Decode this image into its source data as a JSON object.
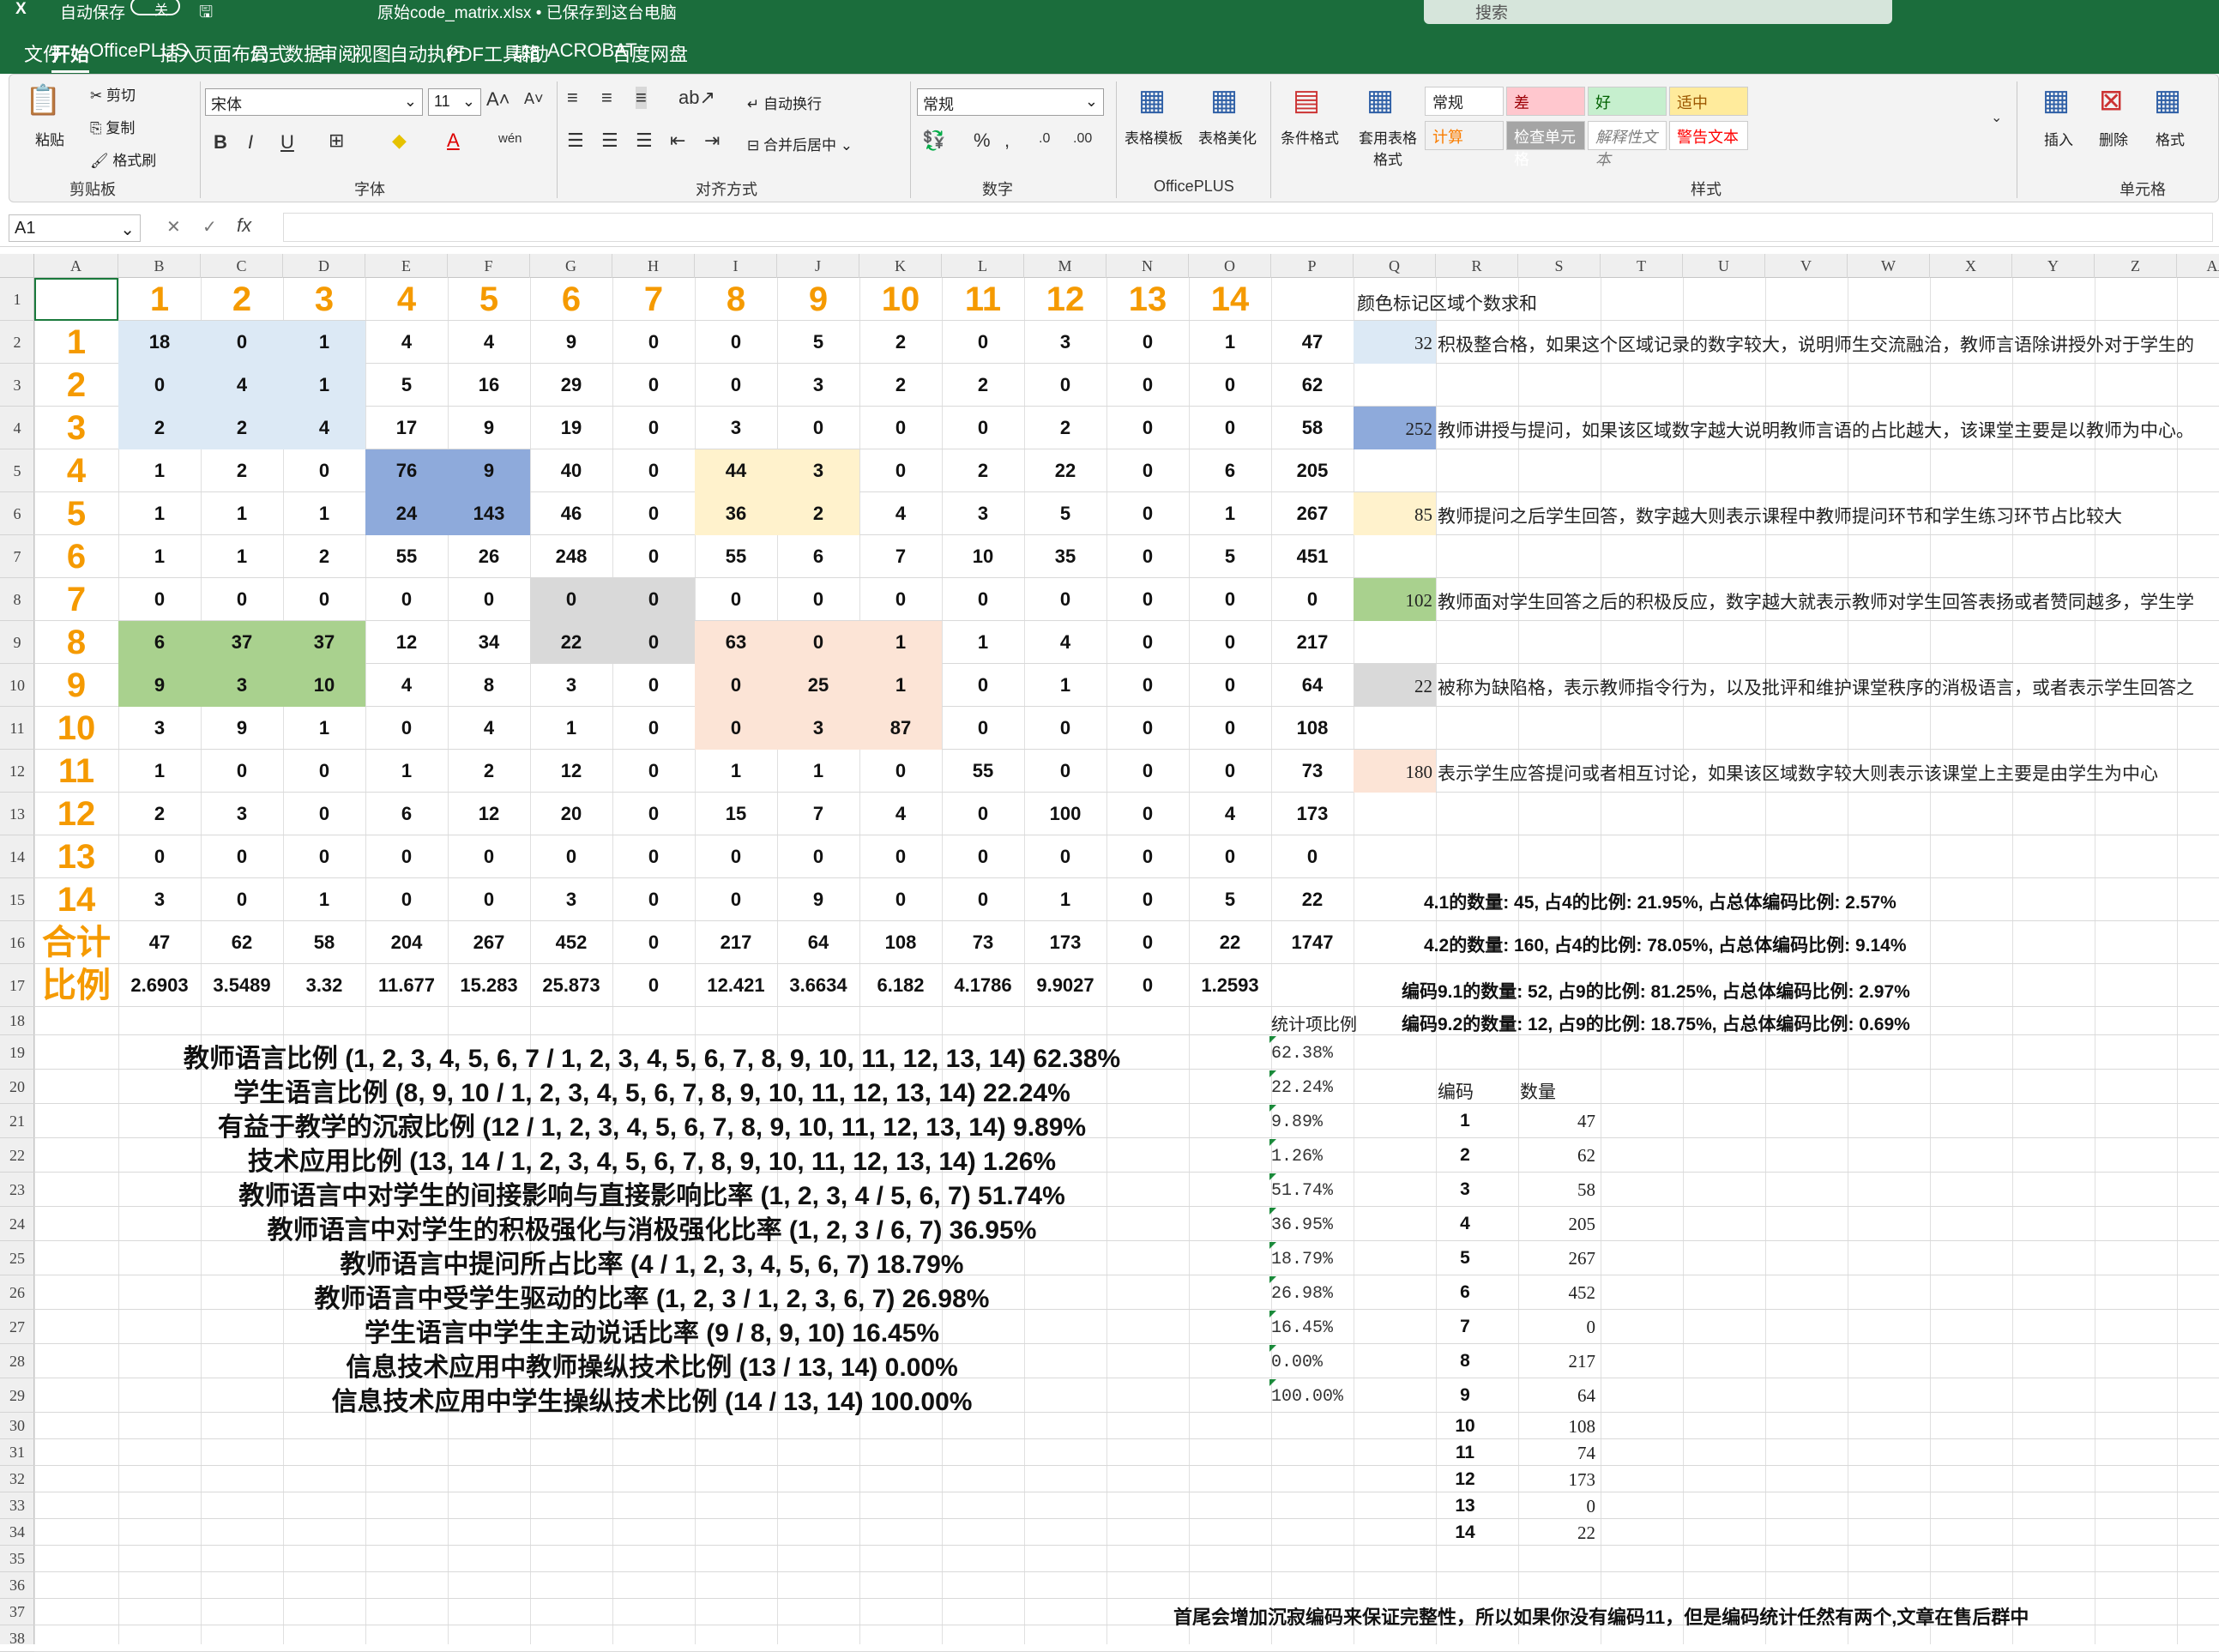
{
  "titlebar": {
    "autosave_label": "自动保存",
    "autosave_state": "关",
    "file_title": "原始code_matrix.xlsx • 已保存到这台电脑",
    "search_placeholder": "搜索"
  },
  "tabs": [
    "文件",
    "开始",
    "OfficePLUS",
    "插入",
    "页面布局",
    "公式",
    "数据",
    "审阅",
    "视图",
    "自动执行",
    "PDF工具箱",
    "帮助",
    "ACROBAT",
    "百度网盘"
  ],
  "ribbon": {
    "clipboard": {
      "paste": "粘贴",
      "cut": "剪切",
      "copy": "复制",
      "format_painter": "格式刷",
      "group": "剪贴板"
    },
    "font": {
      "name": "宋体",
      "size": "11",
      "group": "字体"
    },
    "align": {
      "wrap": "自动换行",
      "merge": "合并后居中",
      "group": "对齐方式"
    },
    "number": {
      "format": "常规",
      "group": "数字"
    },
    "officeplus": {
      "template": "表格模板",
      "beautify": "表格美化",
      "group": "OfficePLUS"
    },
    "styles": {
      "conditional": "条件格式",
      "table_fmt": "套用表格格式",
      "cells": [
        "常规",
        "差",
        "好",
        "适中",
        "计算",
        "检查单元格",
        "解释性文本",
        "警告文本"
      ],
      "group": "样式"
    },
    "cells": {
      "insert": "插入",
      "delete": "删除",
      "format": "格式",
      "group": "单元格"
    }
  },
  "formula_bar": {
    "name_box": "A1",
    "fx": "fx"
  },
  "columns": [
    "A",
    "B",
    "C",
    "D",
    "E",
    "F",
    "G",
    "H",
    "I",
    "J",
    "K",
    "L",
    "M",
    "N",
    "O",
    "P",
    "Q",
    "R",
    "S",
    "T",
    "U",
    "V",
    "W",
    "X",
    "Y",
    "Z",
    "AA"
  ],
  "rows": [
    "1",
    "2",
    "3",
    "4",
    "5",
    "6",
    "7",
    "8",
    "9",
    "10",
    "11",
    "12",
    "13",
    "14",
    "15",
    "16",
    "17",
    "18",
    "19",
    "20",
    "21",
    "22",
    "23",
    "24",
    "25",
    "26",
    "27",
    "28",
    "29",
    "30",
    "31",
    "32",
    "33",
    "34",
    "35",
    "36",
    "37",
    "38"
  ],
  "matrix": {
    "col_headers": [
      "1",
      "2",
      "3",
      "4",
      "5",
      "6",
      "7",
      "8",
      "9",
      "10",
      "11",
      "12",
      "13",
      "14"
    ],
    "row_headers": [
      "1",
      "2",
      "3",
      "4",
      "5",
      "6",
      "7",
      "8",
      "9",
      "10",
      "11",
      "12",
      "13",
      "14"
    ],
    "values": [
      [
        "18",
        "0",
        "1",
        "4",
        "4",
        "9",
        "0",
        "0",
        "5",
        "2",
        "0",
        "3",
        "0",
        "1",
        "47"
      ],
      [
        "0",
        "4",
        "1",
        "5",
        "16",
        "29",
        "0",
        "0",
        "3",
        "2",
        "2",
        "0",
        "0",
        "0",
        "62"
      ],
      [
        "2",
        "2",
        "4",
        "17",
        "9",
        "19",
        "0",
        "3",
        "0",
        "0",
        "0",
        "2",
        "0",
        "0",
        "58"
      ],
      [
        "1",
        "2",
        "0",
        "76",
        "9",
        "40",
        "0",
        "44",
        "3",
        "0",
        "2",
        "22",
        "0",
        "6",
        "205"
      ],
      [
        "1",
        "1",
        "1",
        "24",
        "143",
        "46",
        "0",
        "36",
        "2",
        "4",
        "3",
        "5",
        "0",
        "1",
        "267"
      ],
      [
        "1",
        "1",
        "2",
        "55",
        "26",
        "248",
        "0",
        "55",
        "6",
        "7",
        "10",
        "35",
        "0",
        "5",
        "451"
      ],
      [
        "0",
        "0",
        "0",
        "0",
        "0",
        "0",
        "0",
        "0",
        "0",
        "0",
        "0",
        "0",
        "0",
        "0",
        "0"
      ],
      [
        "6",
        "37",
        "37",
        "12",
        "34",
        "22",
        "0",
        "63",
        "0",
        "1",
        "1",
        "4",
        "0",
        "0",
        "217"
      ],
      [
        "9",
        "3",
        "10",
        "4",
        "8",
        "3",
        "0",
        "0",
        "25",
        "1",
        "0",
        "1",
        "0",
        "0",
        "64"
      ],
      [
        "3",
        "9",
        "1",
        "0",
        "4",
        "1",
        "0",
        "0",
        "3",
        "87",
        "0",
        "0",
        "0",
        "0",
        "108"
      ],
      [
        "1",
        "0",
        "0",
        "1",
        "2",
        "12",
        "0",
        "1",
        "1",
        "0",
        "55",
        "0",
        "0",
        "0",
        "73"
      ],
      [
        "2",
        "3",
        "0",
        "6",
        "12",
        "20",
        "0",
        "15",
        "7",
        "4",
        "0",
        "100",
        "0",
        "4",
        "173"
      ],
      [
        "0",
        "0",
        "0",
        "0",
        "0",
        "0",
        "0",
        "0",
        "0",
        "0",
        "0",
        "0",
        "0",
        "0",
        "0"
      ],
      [
        "3",
        "0",
        "1",
        "0",
        "0",
        "3",
        "0",
        "0",
        "9",
        "0",
        "0",
        "1",
        "0",
        "5",
        "22"
      ]
    ],
    "total_label": "合计",
    "totals": [
      "47",
      "62",
      "58",
      "204",
      "267",
      "452",
      "0",
      "217",
      "64",
      "108",
      "73",
      "173",
      "0",
      "22",
      "1747"
    ],
    "ratio_label": "比例",
    "ratios": [
      "2.6903",
      "3.5489",
      "3.32",
      "11.677",
      "15.283",
      "25.873",
      "0",
      "12.421",
      "3.6634",
      "6.182",
      "4.1786",
      "9.9027",
      "0",
      "1.2593"
    ]
  },
  "color_legend": {
    "title": "颜色标记区域个数求和",
    "items": [
      {
        "value": "32",
        "color": "#dce9f5",
        "text": "积极整合格，如果这个区域记录的数字较大，说明师生交流融洽，教师言语除讲授外对于学生的"
      },
      {
        "value": "252",
        "color": "#8eaadb",
        "text": "教师讲授与提问，如果该区域数字越大说明教师言语的占比越大，该课堂主要是以教师为中心。"
      },
      {
        "value": "85",
        "color": "#fff2cc",
        "text": "教师提问之后学生回答，数字越大则表示课程中教师提问环节和学生练习环节占比较大"
      },
      {
        "value": "102",
        "color": "#a9d18e",
        "text": "教师面对学生回答之后的积极反应，数字越大就表示教师对学生回答表扬或者赞同越多，学生学"
      },
      {
        "value": "22",
        "color": "#d9d9d9",
        "text": "被称为缺陷格，表示教师指令行为，以及批评和维护课堂秩序的消极语言，或者表示学生回答之"
      },
      {
        "value": "180",
        "color": "#fce4d6",
        "text": "表示学生应答提问或者相互讨论，如果该区域数字较大则表示该课堂上主要是由学生为中心"
      }
    ]
  },
  "code_stats": [
    "4.1的数量: 45, 占4的比例: 21.95%, 占总体编码比例: 2.57%",
    "4.2的数量: 160, 占4的比例: 78.05%, 占总体编码比例: 9.14%",
    "编码9.1的数量: 52, 占9的比例: 81.25%, 占总体编码比例: 2.97%",
    "编码9.2的数量: 12, 占9的比例: 18.75%, 占总体编码比例: 0.69%"
  ],
  "stat_header": "统计项比例",
  "stats": [
    {
      "label": "教师语言比例 (1, 2, 3, 4, 5, 6, 7 / 1, 2, 3, 4, 5, 6, 7, 8, 9, 10, 11, 12, 13, 14) 62.38%",
      "pct": "62.38%"
    },
    {
      "label": "学生语言比例 (8, 9, 10 / 1, 2, 3, 4, 5, 6, 7, 8, 9, 10, 11, 12, 13, 14) 22.24%",
      "pct": "22.24%"
    },
    {
      "label": "有益于教学的沉寂比例 (12 / 1, 2, 3, 4, 5, 6, 7, 8, 9, 10, 11, 12, 13, 14) 9.89%",
      "pct": "9.89%"
    },
    {
      "label": "技术应用比例 (13, 14 / 1, 2, 3, 4, 5, 6, 7, 8, 9, 10, 11, 12, 13, 14) 1.26%",
      "pct": "1.26%"
    },
    {
      "label": "教师语言中对学生的间接影响与直接影响比率 (1, 2, 3, 4 / 5, 6, 7) 51.74%",
      "pct": "51.74%"
    },
    {
      "label": "教师语言中对学生的积极强化与消极强化比率 (1, 2, 3 / 6, 7) 36.95%",
      "pct": "36.95%"
    },
    {
      "label": "教师语言中提问所占比率 (4 / 1, 2, 3, 4, 5, 6, 7) 18.79%",
      "pct": "18.79%"
    },
    {
      "label": "教师语言中受学生驱动的比率 (1, 2, 3 / 1, 2, 3, 6, 7) 26.98%",
      "pct": "26.98%"
    },
    {
      "label": "学生语言中学生主动说话比率 (9 / 8, 9, 10) 16.45%",
      "pct": "16.45%"
    },
    {
      "label": "信息技术应用中教师操纵技术比例 (13 / 13, 14) 0.00%",
      "pct": "0.00%"
    },
    {
      "label": "信息技术应用中学生操纵技术比例 (14 / 13, 14) 100.00%",
      "pct": "100.00%"
    }
  ],
  "count_table": {
    "header_code": "编码",
    "header_count": "数量",
    "rows": [
      [
        "1",
        "47"
      ],
      [
        "2",
        "62"
      ],
      [
        "3",
        "58"
      ],
      [
        "4",
        "205"
      ],
      [
        "5",
        "267"
      ],
      [
        "6",
        "452"
      ],
      [
        "7",
        "0"
      ],
      [
        "8",
        "217"
      ],
      [
        "9",
        "64"
      ],
      [
        "10",
        "108"
      ],
      [
        "11",
        "74"
      ],
      [
        "12",
        "173"
      ],
      [
        "13",
        "0"
      ],
      [
        "14",
        "22"
      ]
    ]
  },
  "footer_note": "首尾会增加沉寂编码来保证完整性，所以如果你没有编码11，但是编码统计任然有两个,文章在售后群中"
}
